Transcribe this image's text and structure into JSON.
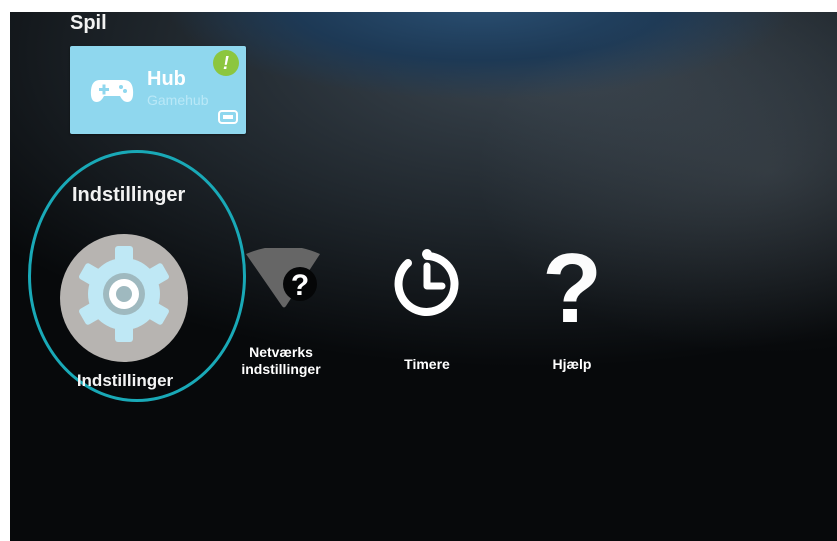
{
  "sections": {
    "games_title": "Spil",
    "settings_title": "Indstillinger"
  },
  "hub_tile": {
    "name": "Hub",
    "subtitle": "Gamehub",
    "badge": "!",
    "icon": "gamepad-icon"
  },
  "settings_items": [
    {
      "label": "Indstillinger",
      "icon": "gear-icon",
      "selected": true
    },
    {
      "label_line1": "Netværks",
      "label_line2": "indstillinger",
      "icon": "wifi-question-icon"
    },
    {
      "label": "Timere",
      "icon": "timer-icon"
    },
    {
      "label": "Hjælp",
      "icon": "help-icon"
    }
  ],
  "colors": {
    "focus_ring": "#19a9b7",
    "hub_tile": "#8fd7ee",
    "badge": "#8cc63f",
    "gear_disc": "#b7b4b1",
    "gear": "#bfe8f5"
  }
}
